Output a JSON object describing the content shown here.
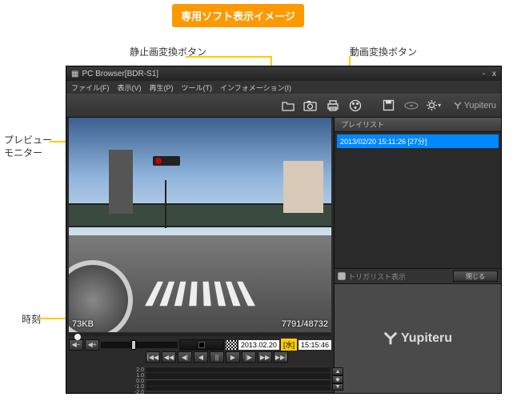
{
  "banner": "専用ソフト表示イメージ",
  "callouts": {
    "still_button": "静止画変換ボタン",
    "movie_button": "動画変換ボタン",
    "preview_monitor": "プレビュー\nモニター",
    "time": "時刻"
  },
  "app": {
    "title": "PC Browser[BDR-S1]",
    "window_buttons": {
      "min": "-",
      "close": "x"
    },
    "menu": {
      "file": "ファイル(F)",
      "view": "表示(V)",
      "play": "再生(P)",
      "tool": "ツール(T)",
      "info": "インフォメーション(I)"
    },
    "brand": "Yupiteru",
    "video": {
      "size_kb": "73KB",
      "frame_counter": "7791/48732"
    },
    "datetime": {
      "date": "2013.02.20",
      "day": "[水]",
      "time": "15:15:46"
    },
    "graph": {
      "labels": [
        "2.0",
        "1.0",
        "0.0",
        "-1.0",
        "-2.0"
      ]
    },
    "playlist": {
      "tab": "プレイリスト",
      "item": "2013/02/20 15:11:26 [27分]",
      "trigger_label": "トリガリスト表示",
      "close": "閉じる"
    }
  }
}
